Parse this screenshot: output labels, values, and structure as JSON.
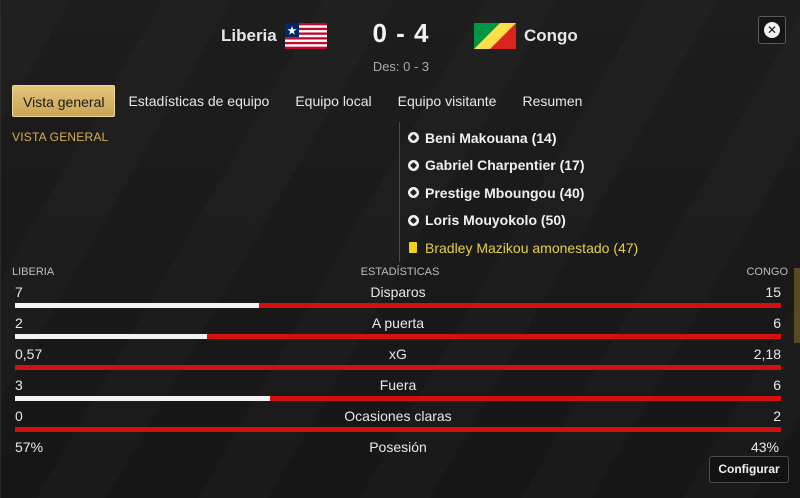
{
  "header": {
    "home_team": "Liberia",
    "away_team": "Congo",
    "score": "0 - 4",
    "halftime": "Des: 0 - 3",
    "home_flag_icon": "liberia-flag-icon",
    "away_flag_icon": "congo-flag-icon"
  },
  "tabs": [
    {
      "label": "Vista general",
      "active": true
    },
    {
      "label": "Estadísticas de equipo",
      "active": false
    },
    {
      "label": "Equipo local",
      "active": false
    },
    {
      "label": "Equipo visitante",
      "active": false
    },
    {
      "label": "Resumen",
      "active": false
    }
  ],
  "overview": {
    "section_title": "VISTA GENERAL",
    "events": [
      {
        "type": "goal",
        "text": "Beni Makouana (14)"
      },
      {
        "type": "goal",
        "text": "Gabriel Charpentier (17)"
      },
      {
        "type": "goal",
        "text": "Prestige Mboungou (40)"
      },
      {
        "type": "goal",
        "text": "Loris Mouyokolo (50)"
      },
      {
        "type": "yellow_card",
        "text": "Bradley Mazikou amonestado (47)"
      }
    ]
  },
  "stats": {
    "home_header": "LIBERIA",
    "title": "ESTADÍSTICAS",
    "away_header": "CONGO",
    "rows": [
      {
        "label": "Disparos",
        "home": "7",
        "away": "15",
        "home_share": 0.318
      },
      {
        "label": "A puerta",
        "home": "2",
        "away": "6",
        "home_share": 0.25
      },
      {
        "label": "xG",
        "home": "0,57",
        "away": "2,18",
        "home_share": 0.0
      },
      {
        "label": "Fuera",
        "home": "3",
        "away": "6",
        "home_share": 0.333
      },
      {
        "label": "Ocasiones claras",
        "home": "0",
        "away": "2",
        "home_share": 0.0
      },
      {
        "label": "Posesión",
        "home": "57%",
        "away": "43%"
      }
    ]
  },
  "footer": {
    "configure_label": "Configurar"
  },
  "colors": {
    "accent_gold": "#d8ad54",
    "bar_away": "#d30f0f",
    "bar_home": "#f2f2f2",
    "yellow_card": "#f3d21f"
  }
}
